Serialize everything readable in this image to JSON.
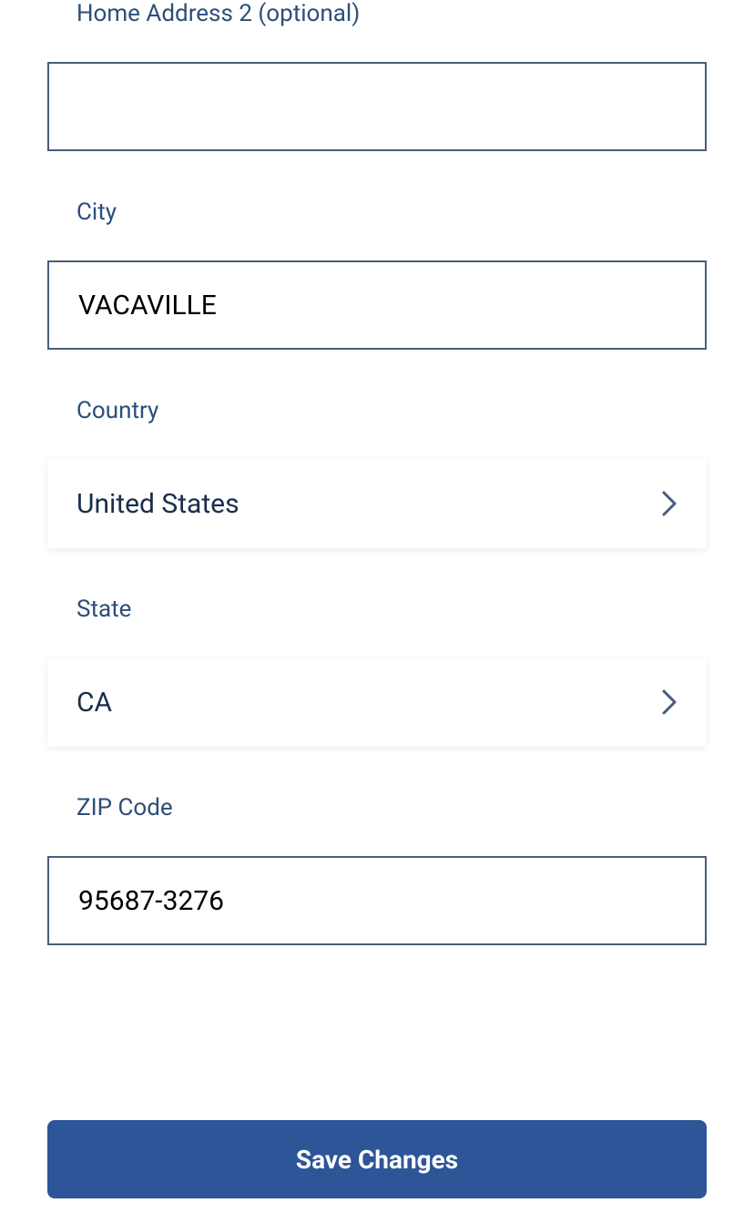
{
  "form": {
    "home_address_2": {
      "label": "Home Address 2 (optional)",
      "value": ""
    },
    "city": {
      "label": "City",
      "value": "VACAVILLE"
    },
    "country": {
      "label": "Country",
      "value": "United States"
    },
    "state": {
      "label": "State",
      "value": "CA"
    },
    "zip_code": {
      "label": "ZIP Code",
      "value": "95687-3276"
    }
  },
  "actions": {
    "save_label": "Save Changes"
  }
}
